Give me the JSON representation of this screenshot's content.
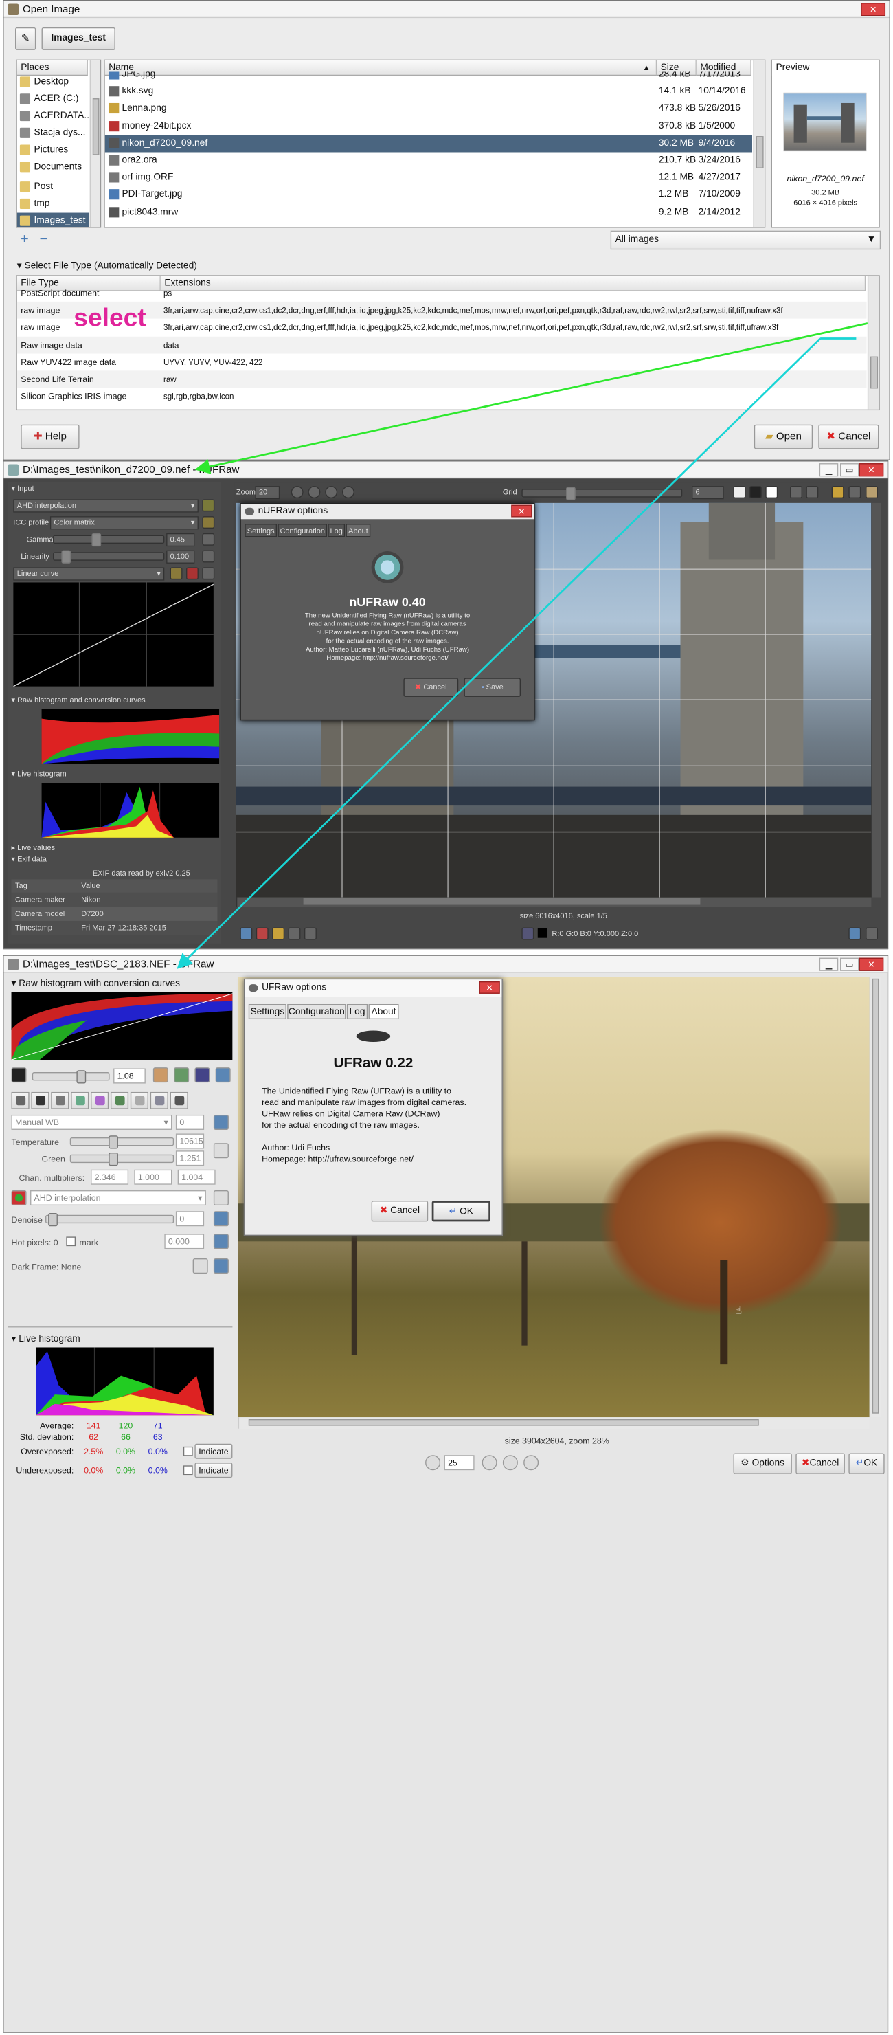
{
  "open_dialog": {
    "title": "Open Image",
    "path_button": "Images_test",
    "places_header": "Places",
    "places": [
      "Desktop",
      "ACER (C:)",
      "ACERDATA...",
      "Stacja dys...",
      "Pictures",
      "Documents",
      "Post",
      "tmp",
      "Images_test"
    ],
    "columns": {
      "name": "Name",
      "size": "Size",
      "modified": "Modified"
    },
    "files": [
      {
        "name": "JPG.jpg",
        "size": "28.4 kB",
        "modified": "7/17/2013"
      },
      {
        "name": "kkk.svg",
        "size": "14.1 kB",
        "modified": "10/14/2016"
      },
      {
        "name": "Lenna.png",
        "size": "473.8 kB",
        "modified": "5/26/2016"
      },
      {
        "name": "money-24bit.pcx",
        "size": "370.8 kB",
        "modified": "1/5/2000"
      },
      {
        "name": "nikon_d7200_09.nef",
        "size": "30.2 MB",
        "modified": "9/4/2016"
      },
      {
        "name": "ora2.ora",
        "size": "210.7 kB",
        "modified": "3/24/2016"
      },
      {
        "name": "orf img.ORF",
        "size": "12.1 MB",
        "modified": "4/27/2017"
      },
      {
        "name": "PDI-Target.jpg",
        "size": "1.2 MB",
        "modified": "7/10/2009"
      },
      {
        "name": "pict8043.mrw",
        "size": "9.2 MB",
        "modified": "2/14/2012"
      }
    ],
    "preview_header": "Preview",
    "preview_name": "nikon_d7200_09.nef",
    "preview_size": "30.2 MB",
    "preview_dims": "6016 × 4016 pixels",
    "filter": "All images",
    "select_type_label": "Select File Type (Automatically Detected)",
    "type_columns": {
      "type": "File Type",
      "ext": "Extensions"
    },
    "types": [
      {
        "type": "PostScript document",
        "ext": "ps"
      },
      {
        "type": "raw image",
        "ext": "3fr,ari,arw,cap,cine,cr2,crw,cs1,dc2,dcr,dng,erf,fff,hdr,ia,iiq,jpeg,jpg,k25,kc2,kdc,mdc,mef,mos,mrw,nef,nrw,orf,ori,pef,pxn,qtk,r3d,raf,raw,rdc,rw2,rwl,sr2,srf,srw,sti,tif,tiff,nufraw,x3f"
      },
      {
        "type": "raw image",
        "ext": "3fr,ari,arw,cap,cine,cr2,crw,cs1,dc2,dcr,dng,erf,fff,hdr,ia,iiq,jpeg,jpg,k25,kc2,kdc,mdc,mef,mos,mrw,nef,nrw,orf,ori,pef,pxn,qtk,r3d,raf,raw,rdc,rw2,rwl,sr2,srf,srw,sti,tif,tiff,ufraw,x3f"
      },
      {
        "type": "Raw image data",
        "ext": "data"
      },
      {
        "type": "Raw YUV422 image data",
        "ext": "UYVY, YUYV, YUV-422, 422"
      },
      {
        "type": "Second Life Terrain",
        "ext": "raw"
      },
      {
        "type": "Silicon Graphics IRIS image",
        "ext": "sgi,rgb,rgba,bw,icon"
      }
    ],
    "annotation": "select",
    "help": "Help",
    "open": "Open",
    "cancel": "Cancel"
  },
  "nufraw": {
    "title": "D:\\Images_test\\nikon_d7200_09.nef - nUFRaw",
    "input": "Input",
    "interp": "AHD interpolation",
    "icc_label": "ICC profile",
    "icc": "Color matrix",
    "gamma_label": "Gamma",
    "gamma": "0.45",
    "linearity_label": "Linearity",
    "linearity": "0.100",
    "curve": "Linear curve",
    "raw_hist": "Raw histogram and conversion curves",
    "live_hist": "Live histogram",
    "live_values": "Live values",
    "exif": "Exif data",
    "exif_read": "EXIF data read by exiv2 0.25",
    "exif_cols": {
      "tag": "Tag",
      "value": "Value"
    },
    "exif_rows": [
      {
        "tag": "Camera maker",
        "value": "Nikon"
      },
      {
        "tag": "Camera model",
        "value": "D7200"
      },
      {
        "tag": "Timestamp",
        "value": "Fri Mar 27 12:18:35 2015"
      }
    ],
    "zoom_label": "Zoom",
    "zoom": "20",
    "grid_label": "Grid",
    "grid": "6",
    "size": "size 6016x4016, scale 1/5",
    "pixel": "R:0 G:0 B:0 Y:0.000 Z:0.0",
    "dialog": {
      "title": "nUFRaw options",
      "tabs": [
        "Settings",
        "Configuration",
        "Log",
        "About"
      ],
      "name": "nUFRaw 0.40",
      "lines": [
        "The new Unidentified Flying Raw (nUFRaw) is a utility to",
        "read and manipulate raw images from digital cameras",
        "nUFRaw relies on Digital Camera Raw (DCRaw)",
        "for the actual encoding of the raw images.",
        "Author: Matteo Lucarelli (nUFRaw), Udi Fuchs (UFRaw)",
        "Homepage: http://nufraw.sourceforge.net/"
      ],
      "cancel": "Cancel",
      "save": "Save"
    }
  },
  "ufraw": {
    "title": "D:\\Images_test\\DSC_2183.NEF - UFRaw",
    "raw_hist": "Raw histogram with conversion curves",
    "exposure": "1.08",
    "wb": "Manual WB",
    "wb_val": "0",
    "temp_label": "Temperature",
    "temp": "10615",
    "green_label": "Green",
    "green": "1.251",
    "chan_label": "Chan. multipliers:",
    "chan": [
      "2.346",
      "1.000",
      "1.004"
    ],
    "interp": "AHD interpolation",
    "denoise_label": "Denoise",
    "denoise": "0",
    "hot_label": "Hot pixels: 0",
    "mark": "mark",
    "hot": "0.000",
    "dark_frame": "Dark Frame: None",
    "live_hist": "Live histogram",
    "stats": {
      "average_label": "Average:",
      "average": [
        "141",
        "120",
        "71"
      ],
      "std_label": "Std. deviation:",
      "std": [
        "62",
        "66",
        "63"
      ],
      "over_label": "Overexposed:",
      "over": [
        "2.5%",
        "0.0%",
        "0.0%"
      ],
      "under_label": "Underexposed:",
      "under": [
        "0.0%",
        "0.0%",
        "0.0%"
      ],
      "indicate": "Indicate"
    },
    "size": "size 3904x2604, zoom 28%",
    "zoom": "25",
    "options": "Options",
    "cancel": "Cancel",
    "ok": "OK",
    "dialog": {
      "title": "UFRaw options",
      "tabs": [
        "Settings",
        "Configuration",
        "Log",
        "About"
      ],
      "name": "UFRaw 0.22",
      "lines": [
        "The Unidentified Flying Raw (UFRaw) is a utility to",
        "read and manipulate raw images from digital cameras.",
        "UFRaw relies on Digital Camera Raw (DCRaw)",
        "for the actual encoding of the raw images.",
        "",
        "Author: Udi Fuchs",
        "Homepage: http://ufraw.sourceforge.net/"
      ],
      "cancel": "Cancel",
      "ok": "OK"
    }
  },
  "colors": {
    "selection": "#4a6580",
    "annotation": "#e0249a",
    "green_arrow": "#2ee82e",
    "cyan_arrow": "#19d5d5"
  }
}
